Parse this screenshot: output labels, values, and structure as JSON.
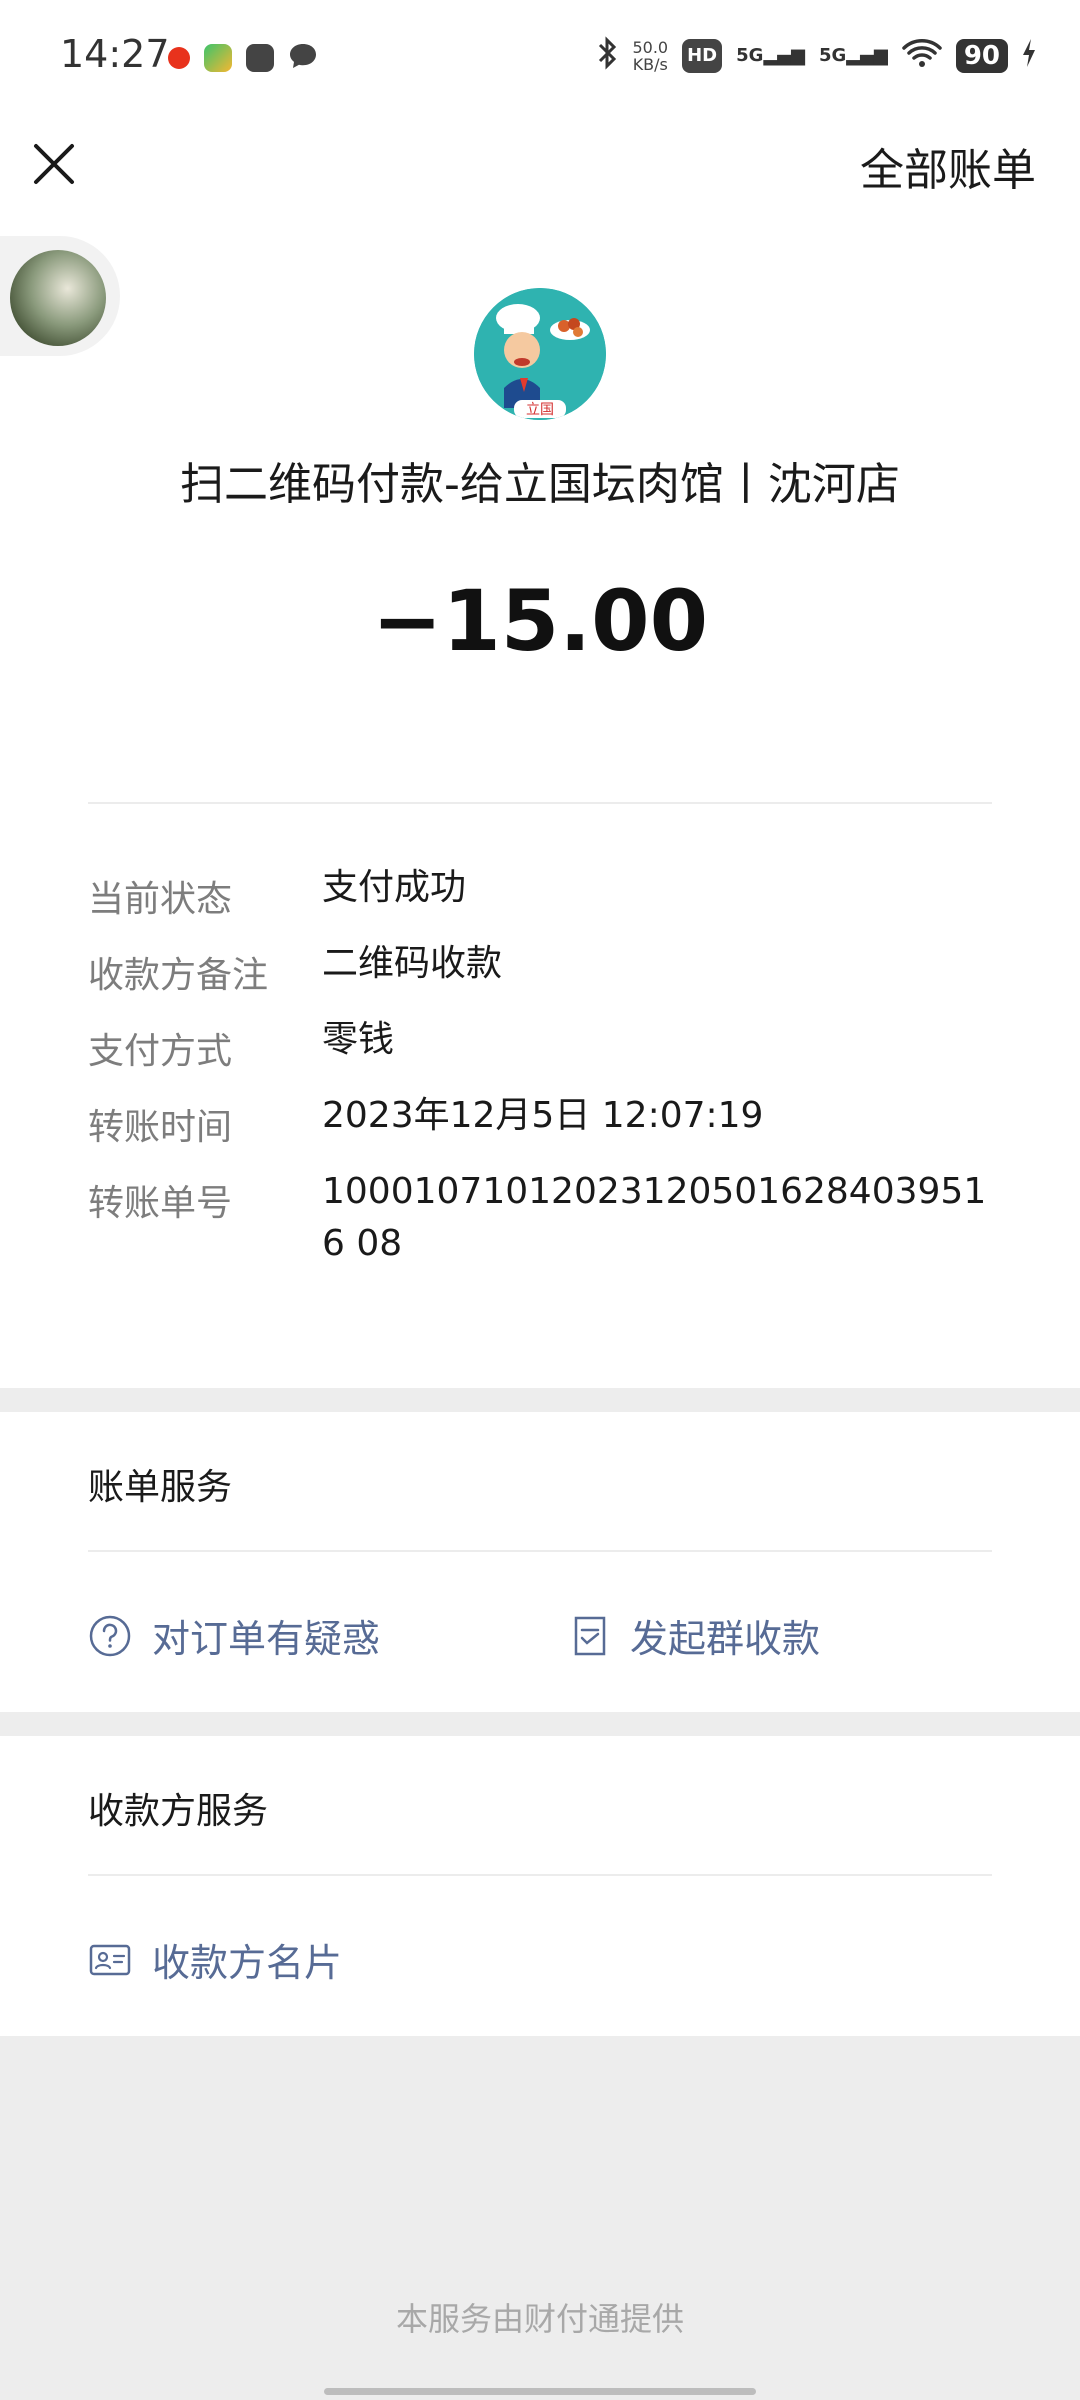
{
  "status_bar": {
    "time": "14:27",
    "net_speed_value": "50.0",
    "net_speed_unit": "KB/s",
    "hd_label": "HD",
    "signal1": "5G",
    "signal2": "5G",
    "battery": "90"
  },
  "nav": {
    "close_icon": "close-icon",
    "all_bills": "全部账单"
  },
  "merchant": {
    "logo_text": "立国",
    "title": "扫二维码付款-给立国坛肉馆丨沈河店",
    "amount": "−15.00"
  },
  "details": [
    {
      "label": "当前状态",
      "value": "支付成功"
    },
    {
      "label": "收款方备注",
      "value": "二维码收款"
    },
    {
      "label": "支付方式",
      "value": "零钱"
    },
    {
      "label": "转账时间",
      "value": "2023年12月5日 12:07:19"
    },
    {
      "label": "转账单号",
      "value": "100010710120231205016284039516 08"
    }
  ],
  "bill_service": {
    "title": "账单服务",
    "question_link": "对订单有疑惑",
    "group_collect_link": "发起群收款"
  },
  "payee_service": {
    "title": "收款方服务",
    "card_link": "收款方名片"
  },
  "footer": "本服务由财付通提供",
  "colors": {
    "link": "#576b95",
    "label": "#7d7d7d",
    "background": "#ededed"
  }
}
